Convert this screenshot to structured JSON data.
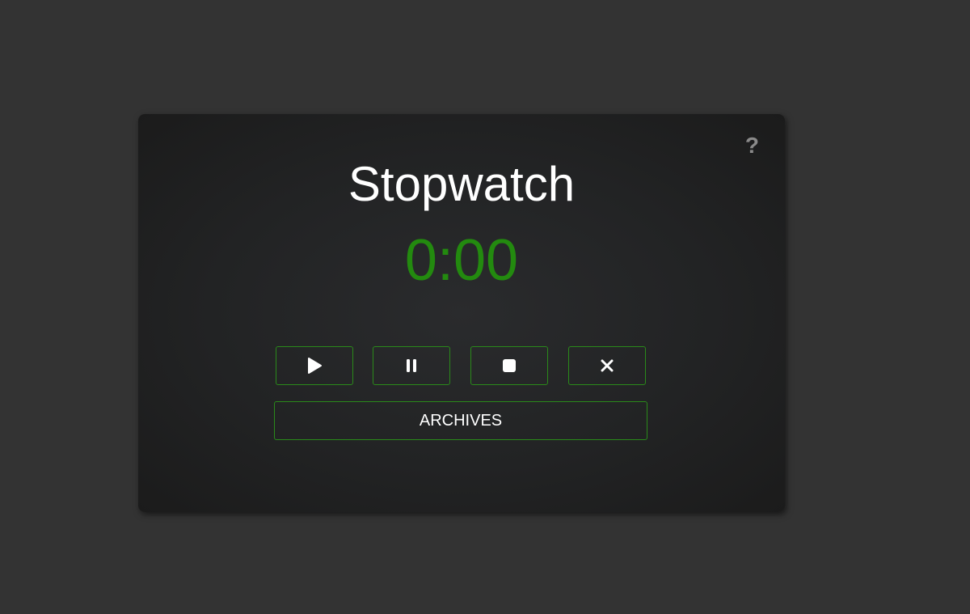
{
  "app": {
    "title": "Stopwatch",
    "time": "0:00",
    "help_label": "?"
  },
  "controls": [
    {
      "name": "play",
      "icon": "play-icon"
    },
    {
      "name": "pause",
      "icon": "pause-icon"
    },
    {
      "name": "stop",
      "icon": "stop-icon"
    },
    {
      "name": "reset",
      "icon": "close-icon"
    }
  ],
  "archives": {
    "label": "ARCHIVES"
  },
  "colors": {
    "background": "#333333",
    "card": "#222324",
    "accent_green": "#238a0f",
    "border_green": "#2a8a1a",
    "text": "#ffffff",
    "muted": "#8a8a8a"
  }
}
